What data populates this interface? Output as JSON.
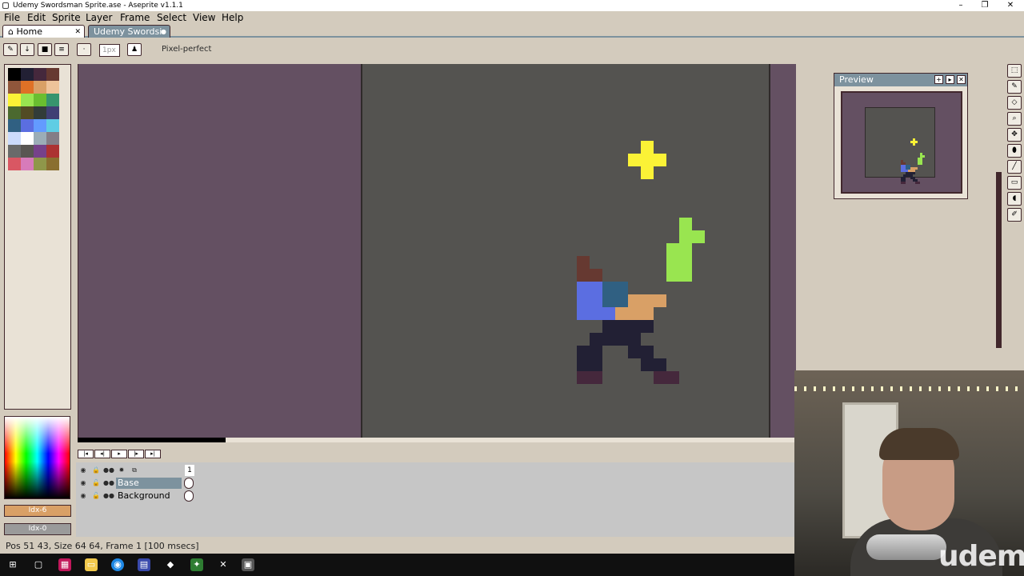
{
  "window": {
    "title": "Udemy Swordsman Sprite.ase - Aseprite v1.1.1",
    "minimize": "–",
    "restore": "❐",
    "close": "✕"
  },
  "menu": [
    "File",
    "Edit",
    "Sprite",
    "Layer",
    "Frame",
    "Select",
    "View",
    "Help"
  ],
  "tabs": [
    {
      "label": "Home",
      "close": "✕"
    },
    {
      "label": "Udemy Swordsi",
      "dot": "●"
    }
  ],
  "toolbar": {
    "brush_size": "1px",
    "pixel_perfect": "Pixel-perfect"
  },
  "palette": {
    "colors": [
      "#000000",
      "#222034",
      "#45283c",
      "#663931",
      "#8f563b",
      "#df7126",
      "#d9a066",
      "#eec39a",
      "#fbf236",
      "#99e550",
      "#6abe30",
      "#37946e",
      "#4b692f",
      "#524b24",
      "#323c39",
      "#3f3f74",
      "#306082",
      "#5b6ee1",
      "#639bff",
      "#5fcde4",
      "#cbdbfc",
      "#ffffff",
      "#9badb7",
      "#847e87",
      "#696a6a",
      "#595652",
      "#76428a",
      "#ac3232",
      "#d95763",
      "#d77bba",
      "#8f974a",
      "#8a6f30"
    ]
  },
  "colorbar": {
    "fg": "Idx-6",
    "bg": "Idx-0"
  },
  "preview": {
    "title": "Preview"
  },
  "timeline": {
    "frame_number": "1",
    "layers": [
      {
        "name": "Base"
      },
      {
        "name": "Background"
      }
    ]
  },
  "status": {
    "text": "Pos 51 43, Size 64 64, Frame 1 [100 msecs]"
  },
  "webcam": {
    "watermark": "udemy"
  }
}
